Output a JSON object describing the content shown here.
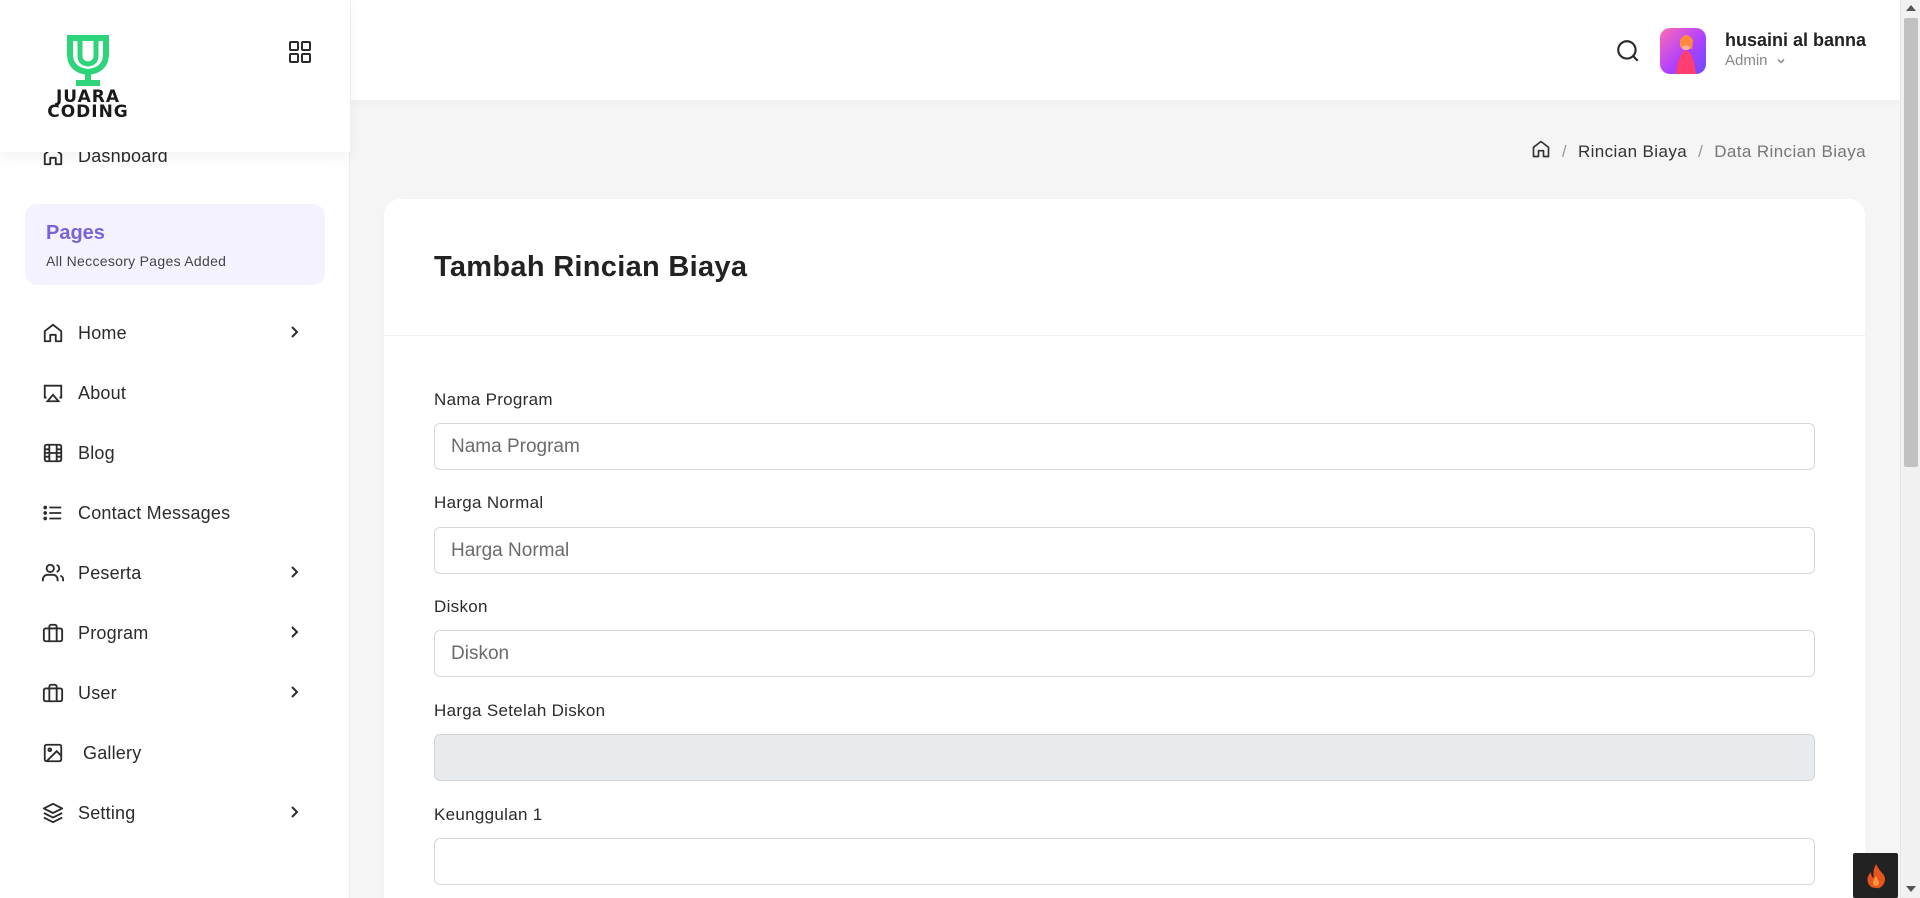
{
  "brand": {
    "logo_text_line1": "JUARA",
    "logo_text_line2": "CODING",
    "accent": "#2ed47a"
  },
  "sidebar": {
    "dashboard_label": "Dashboard",
    "pages_title": "Pages",
    "pages_subtitle": "All Neccesory Pages Added",
    "items": [
      {
        "label": "Home",
        "icon": "home-icon",
        "has_submenu": true
      },
      {
        "label": "About",
        "icon": "airplay-icon",
        "has_submenu": false
      },
      {
        "label": "Blog",
        "icon": "film-icon",
        "has_submenu": false
      },
      {
        "label": "Contact Messages",
        "icon": "list-icon",
        "has_submenu": false
      },
      {
        "label": "Peserta",
        "icon": "users-icon",
        "has_submenu": true
      },
      {
        "label": "Program",
        "icon": "briefcase-icon",
        "has_submenu": true
      },
      {
        "label": "User",
        "icon": "briefcase-icon",
        "has_submenu": true
      },
      {
        "label": "Gallery",
        "icon": "image-icon",
        "has_submenu": false
      },
      {
        "label": "Setting",
        "icon": "layers-icon",
        "has_submenu": true
      }
    ]
  },
  "header": {
    "user_name": "husaini al banna",
    "user_role": "Admin"
  },
  "breadcrumb": {
    "items": [
      "Rincian Biaya",
      "Data Rincian Biaya"
    ]
  },
  "form": {
    "title": "Tambah Rincian Biaya",
    "fields": [
      {
        "label": "Nama Program",
        "placeholder": "Nama Program",
        "value": ""
      },
      {
        "label": "Harga Normal",
        "placeholder": "Harga Normal",
        "value": ""
      },
      {
        "label": "Diskon",
        "placeholder": "Diskon",
        "value": ""
      },
      {
        "label": "Harga Setelah Diskon",
        "placeholder": "",
        "value": "",
        "readonly": true
      },
      {
        "label": "Keunggulan 1",
        "placeholder": "",
        "value": ""
      }
    ]
  },
  "colors": {
    "pages_accent": "#7a63d9",
    "pages_bg": "#f4f2fe",
    "readonly_bg": "#e8ebee"
  }
}
